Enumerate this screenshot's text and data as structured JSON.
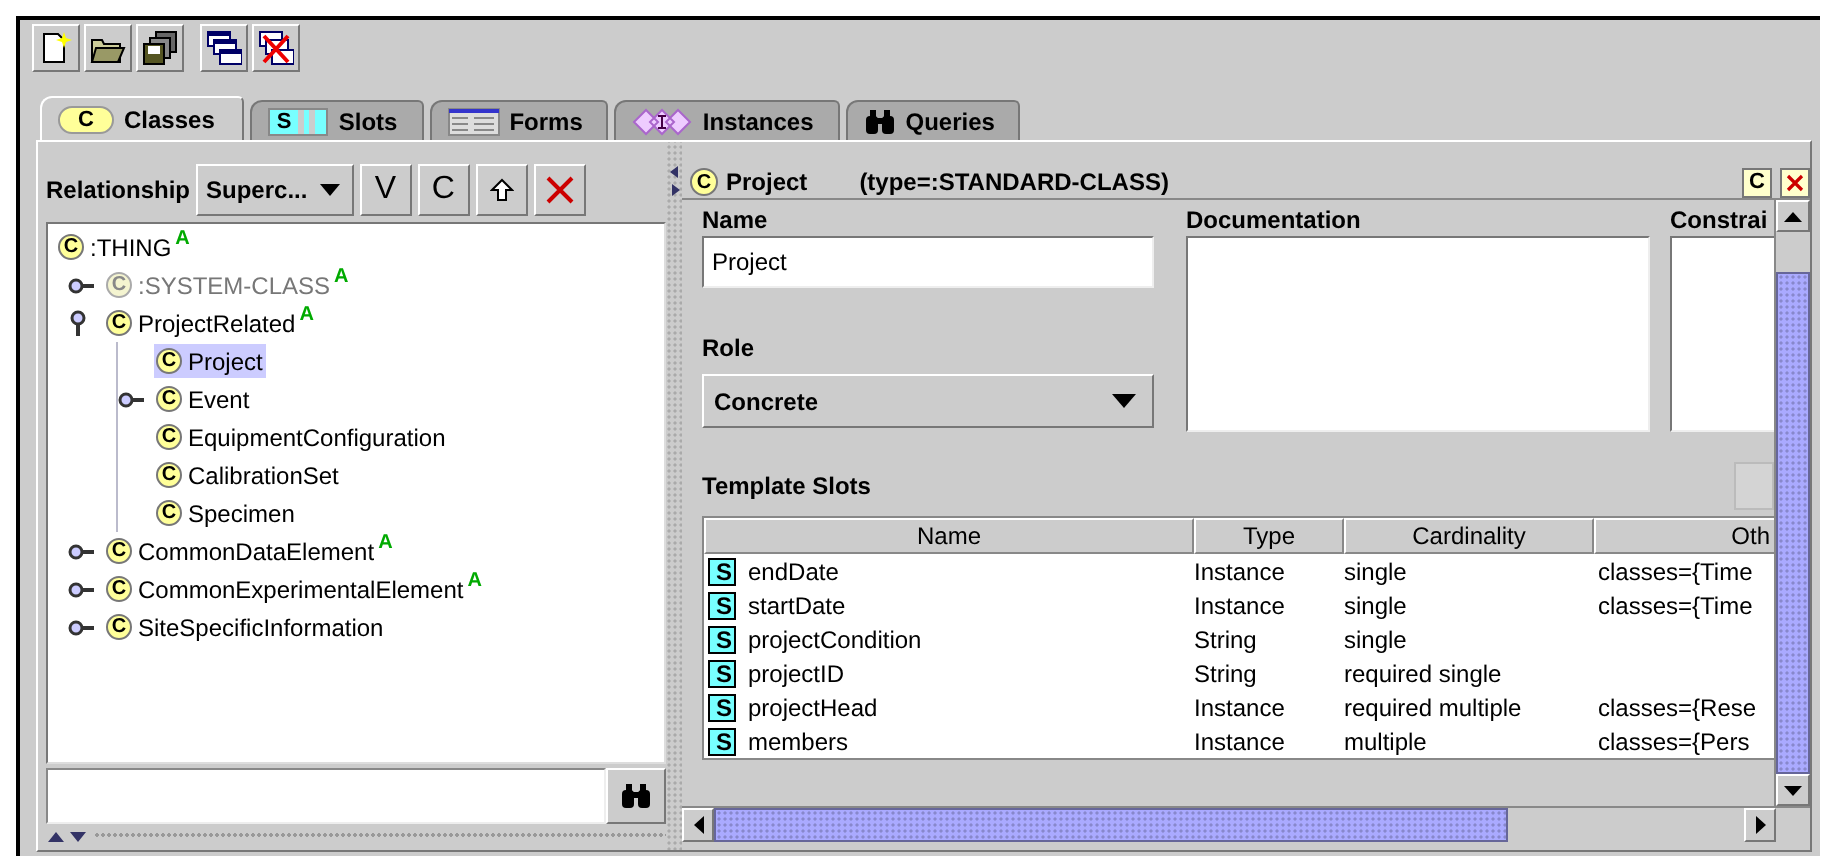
{
  "toolbar": [
    [
      {
        "kind": "new-file"
      },
      {
        "kind": "open-folder"
      },
      {
        "kind": "save-all"
      }
    ],
    [
      {
        "kind": "windows"
      },
      {
        "kind": "close-windows"
      }
    ]
  ],
  "tabs": [
    {
      "label": "Classes",
      "kind": "classes",
      "icon_text": "C",
      "selected": true
    },
    {
      "label": "Slots",
      "kind": "slots",
      "icon_text": "S",
      "selected": false
    },
    {
      "label": "Forms",
      "kind": "forms",
      "selected": false
    },
    {
      "label": "Instances",
      "kind": "instances",
      "selected": false
    },
    {
      "label": "Queries",
      "kind": "queries",
      "selected": false
    }
  ],
  "class_browser": {
    "relationship_label": "Relationship",
    "relationship_value": "Superc...",
    "buttons": [
      {
        "kind": "text",
        "label": "V"
      },
      {
        "kind": "text",
        "label": "C"
      },
      {
        "kind": "up"
      },
      {
        "kind": "delete"
      }
    ],
    "tree": [
      {
        "label": ":THING",
        "icon": "C",
        "flag": "A",
        "selected": false,
        "greyed": false,
        "children": [
          {
            "label": ":SYSTEM-CLASS",
            "icon": "C",
            "flag": "A",
            "selected": false,
            "greyed": true,
            "expanded": false
          },
          {
            "label": "ProjectRelated",
            "icon": "C",
            "flag": "A",
            "selected": false,
            "greyed": false,
            "expanded": true,
            "children": [
              {
                "label": "Project",
                "icon": "C",
                "selected": true,
                "greyed": false
              },
              {
                "label": "Event",
                "icon": "C",
                "selected": false,
                "greyed": false,
                "expanded": false
              },
              {
                "label": "EquipmentConfiguration",
                "icon": "C",
                "selected": false,
                "greyed": false
              },
              {
                "label": "CalibrationSet",
                "icon": "C",
                "selected": false,
                "greyed": false
              },
              {
                "label": "Specimen",
                "icon": "C",
                "selected": false,
                "greyed": false
              }
            ]
          },
          {
            "label": "CommonDataElement",
            "icon": "C",
            "flag": "A",
            "selected": false,
            "greyed": false,
            "expanded": false
          },
          {
            "label": "CommonExperimentalElement",
            "icon": "C",
            "flag": "A",
            "selected": false,
            "greyed": false,
            "expanded": false
          },
          {
            "label": "SiteSpecificInformation",
            "icon": "C",
            "selected": false,
            "greyed": false,
            "expanded": false
          }
        ]
      }
    ]
  },
  "class_form": {
    "header": {
      "icon": "C",
      "name": "Project",
      "type": "(type=:STANDARD-CLASS)",
      "buttons": [
        {
          "kind": "text",
          "label": "C"
        },
        {
          "kind": "close"
        }
      ]
    },
    "name_label": "Name",
    "name_value": "Project",
    "documentation_label": "Documentation",
    "constraints_label": "Constrai",
    "role_label": "Role",
    "role_value": "Concrete",
    "template_slots_label": "Template Slots",
    "table": {
      "columns": [
        "Name",
        "Type",
        "Cardinality",
        "Oth"
      ],
      "rows": [
        {
          "icon": "S",
          "name": "endDate",
          "type": "Instance",
          "cardinality": "single",
          "other": "classes={Time"
        },
        {
          "icon": "S",
          "name": "startDate",
          "type": "Instance",
          "cardinality": "single",
          "other": "classes={Time"
        },
        {
          "icon": "S",
          "name": "projectCondition",
          "type": "String",
          "cardinality": "single"
        },
        {
          "icon": "S",
          "name": "projectID",
          "type": "String",
          "cardinality": "required single"
        },
        {
          "icon": "S",
          "name": "projectHead",
          "type": "Instance",
          "cardinality": "required multiple",
          "other": "classes={Rese"
        },
        {
          "icon": "S",
          "name": "members",
          "type": "Instance",
          "cardinality": "multiple",
          "other": "classes={Pers"
        }
      ]
    }
  }
}
